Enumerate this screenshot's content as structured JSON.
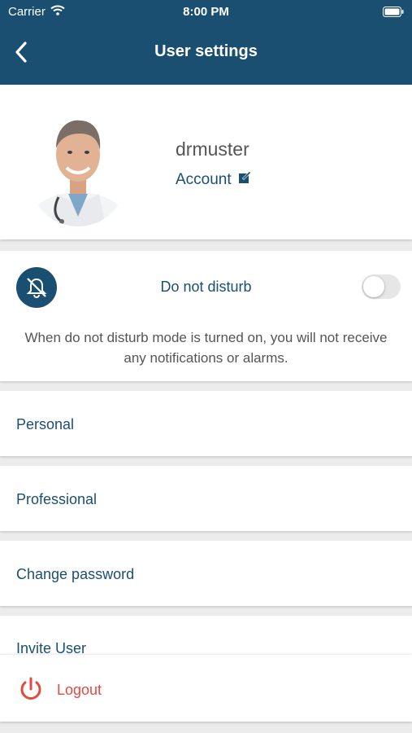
{
  "status_bar": {
    "carrier": "Carrier",
    "time": "8:00 PM"
  },
  "header": {
    "title": "User settings",
    "back_icon": "chevron-left-icon"
  },
  "profile": {
    "username": "drmuster",
    "account_label": "Account",
    "edit_icon": "edit-icon"
  },
  "do_not_disturb": {
    "title": "Do not disturb",
    "enabled": false,
    "description": "When do not disturb mode is turned on, you will not receive any notifications or alarms.",
    "icon": "bell-slash-icon"
  },
  "menu": {
    "items": [
      {
        "label": "Personal"
      },
      {
        "label": "Professional"
      },
      {
        "label": "Change password"
      },
      {
        "label": "Invite User"
      }
    ]
  },
  "logout": {
    "label": "Logout",
    "icon": "power-icon"
  },
  "colors": {
    "primary": "#1b4f72",
    "danger": "#e24a3f",
    "background": "#ececec"
  }
}
